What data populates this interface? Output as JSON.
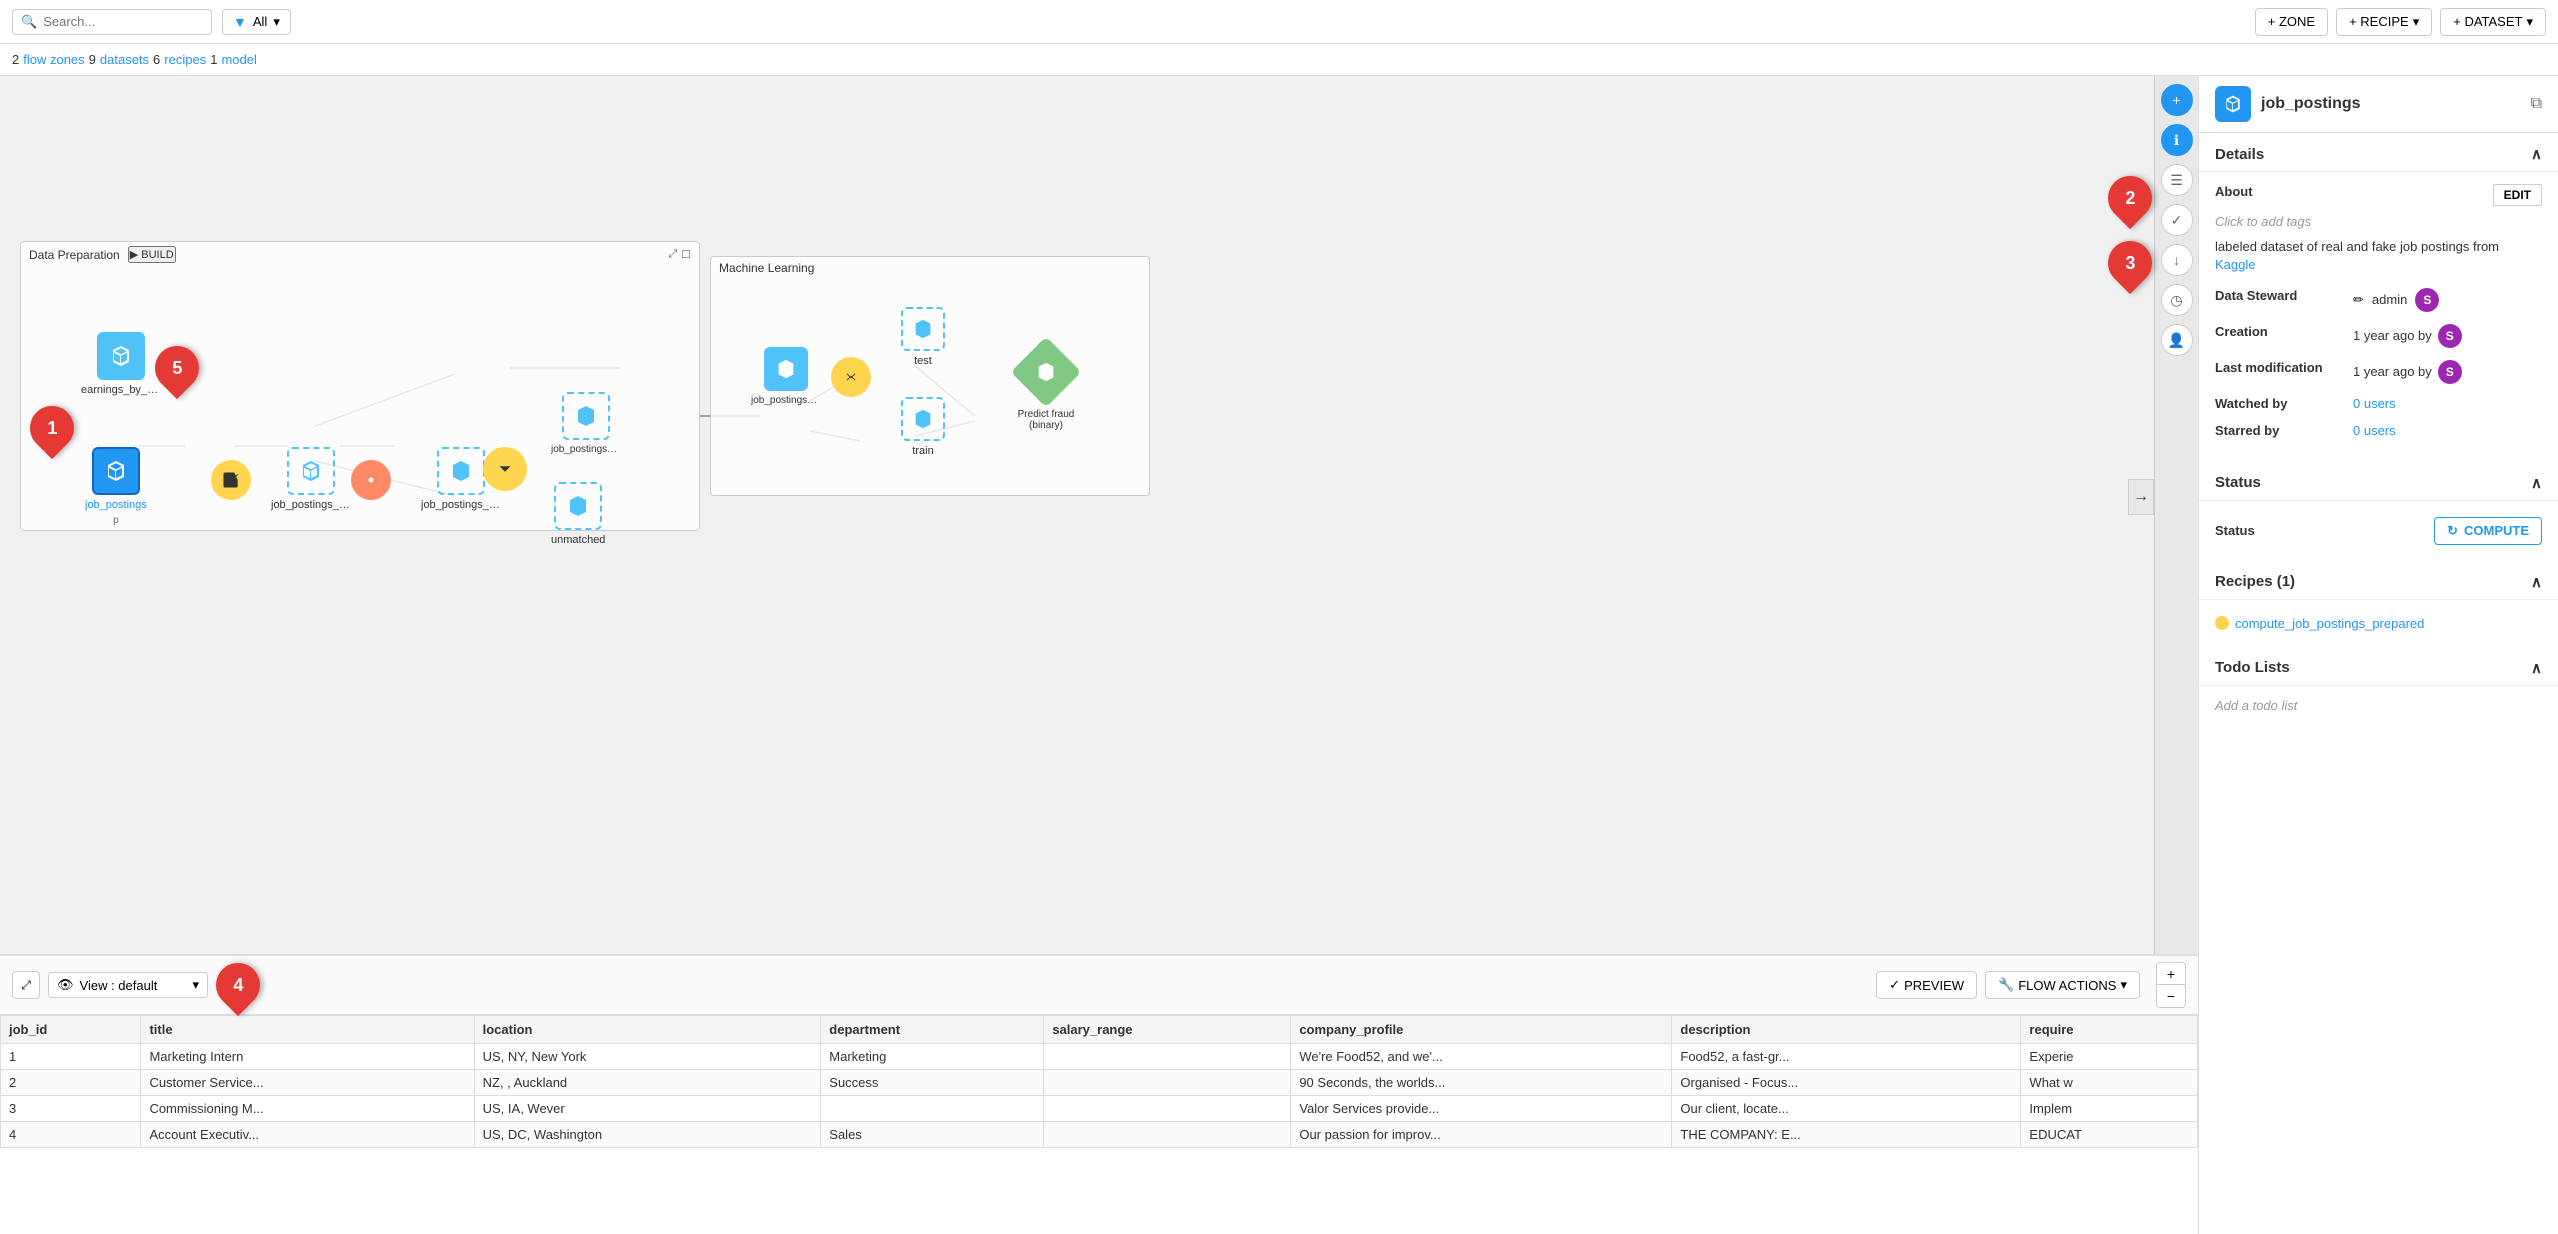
{
  "toolbar": {
    "search_placeholder": "Search...",
    "filter_label": "All",
    "zone_btn": "+ ZONE",
    "recipe_btn": "+ RECIPE",
    "dataset_btn": "+ DATASET"
  },
  "sub_toolbar": {
    "text": "2 flow zones 9 datasets 6 recipes 1 model",
    "flow_zones": "2",
    "flow_zones_label": "flow zones",
    "datasets": "9",
    "datasets_label": "datasets",
    "recipes": "6",
    "recipes_label": "recipes",
    "model": "1",
    "model_label": "model"
  },
  "zones": {
    "data_prep": {
      "title": "Data Preparation",
      "build_btn": "▶ BUILD"
    },
    "machine_learning": {
      "title": "Machine Learning"
    }
  },
  "nodes": {
    "job_postings": {
      "label": "job_postings"
    },
    "job_postings_prepared": {
      "label": "job_postings_prepared"
    },
    "job_postings_python": {
      "label": "job_postings_python"
    },
    "job_postings_prepared_joined": {
      "label": "job_postings_prepared_joined"
    },
    "unmatched": {
      "label": "unmatched"
    },
    "earnings_by_education": {
      "label": "earnings_by_education"
    },
    "job_postings_prepared_joined_ml": {
      "label": "job_postings_prepared_joined"
    },
    "test": {
      "label": "test"
    },
    "train": {
      "label": "train"
    },
    "predict_fraud": {
      "label": "Predict fraud (binary)"
    }
  },
  "bottom_bar": {
    "view_label": "View : default",
    "preview_btn": "PREVIEW",
    "flow_actions_btn": "FLOW ACTIONS"
  },
  "table": {
    "columns": [
      "job_id",
      "title",
      "location",
      "department",
      "salary_range",
      "company_profile",
      "description",
      "require"
    ],
    "rows": [
      {
        "job_id": "1",
        "title": "Marketing Intern",
        "location": "US, NY, New York",
        "department": "Marketing",
        "salary_range": "",
        "company_profile": "We're Food52, and we'...",
        "description": "Food52, a fast-gr...",
        "require": "Experie"
      },
      {
        "job_id": "2",
        "title": "Customer Service...",
        "location": "NZ, , Auckland",
        "department": "Success",
        "salary_range": "",
        "company_profile": "90 Seconds, the worlds...",
        "description": "Organised - Focus...",
        "require": "What w"
      },
      {
        "job_id": "3",
        "title": "Commissioning M...",
        "location": "US, IA, Wever",
        "department": "",
        "salary_range": "",
        "company_profile": "Valor Services provide...",
        "description": "Our client, locate...",
        "require": "Implem"
      },
      {
        "job_id": "4",
        "title": "Account Executiv...",
        "location": "US, DC, Washington",
        "department": "Sales",
        "salary_range": "",
        "company_profile": "Our passion for improv...",
        "description": "THE COMPANY: E...",
        "require": "EDUCAT"
      }
    ]
  },
  "right_panel": {
    "title": "job_postings",
    "details_label": "Details",
    "about_label": "About",
    "edit_btn": "EDIT",
    "click_add_tags": "Click to add tags",
    "description": "labeled dataset of real and fake job postings from",
    "description_link": "Kaggle",
    "data_steward_label": "Data Steward",
    "data_steward_value": "admin",
    "creation_label": "Creation",
    "creation_value": "1 year ago by",
    "last_mod_label": "Last modification",
    "last_mod_value": "1 year ago by",
    "watched_label": "Watched by",
    "watched_value": "0 users",
    "starred_label": "Starred by",
    "starred_value": "0 users",
    "status_section": "Status",
    "status_label": "Status",
    "compute_btn": "COMPUTE",
    "recipes_section": "Recipes (1)",
    "recipe_name": "compute_job_postings_prepared",
    "todo_section": "Todo Lists",
    "todo_add": "Add a todo list"
  },
  "annotations": {
    "bubble1": "1",
    "bubble2": "2",
    "bubble3": "3",
    "bubble4": "4",
    "bubble5": "5"
  }
}
